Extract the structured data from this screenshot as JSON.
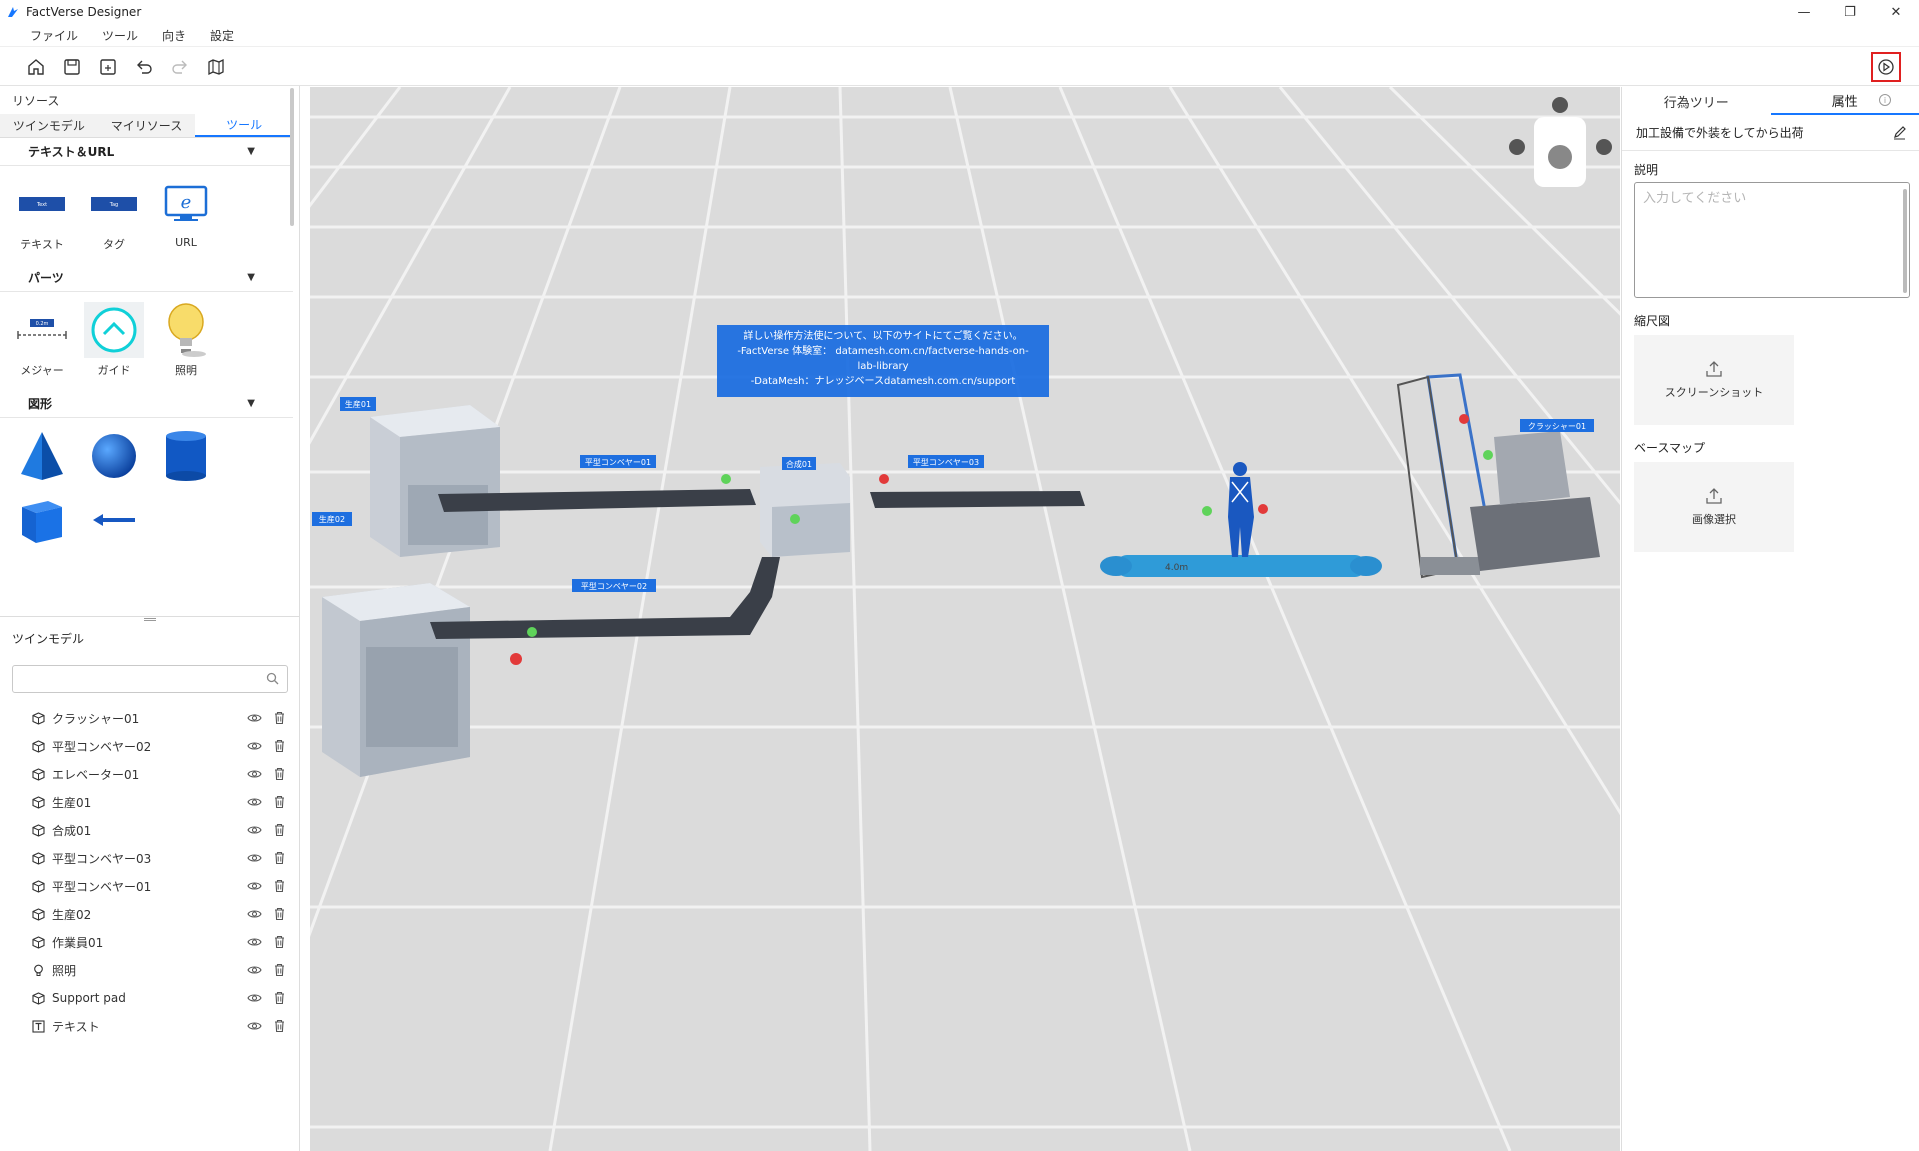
{
  "window": {
    "title": "FactVerse Designer",
    "minimize": "—",
    "restore": "❐",
    "close": "✕"
  },
  "menu": [
    "ファイル",
    "ツール",
    "向き",
    "設定"
  ],
  "left": {
    "resources_title": "リソース",
    "tabs": [
      {
        "label": "ツインモデル"
      },
      {
        "label": "マイリソース"
      },
      {
        "label": "ツール"
      }
    ],
    "groups": {
      "text_url": {
        "title": "テキスト＆URL",
        "items": [
          "テキスト",
          "タグ",
          "URL"
        ]
      },
      "parts": {
        "title": "パーツ",
        "items": [
          "メジャー",
          "ガイド",
          "照明"
        ]
      },
      "shapes": {
        "title": "図形"
      }
    },
    "tool_thumbs": {
      "text": "Text",
      "tag": "Tag",
      "measure": "0.2m"
    },
    "twin_title": "ツインモデル",
    "search_placeholder": "",
    "models": [
      {
        "label": "クラッシャー01",
        "icon": "cube-icon"
      },
      {
        "label": "平型コンベヤー02",
        "icon": "cube-icon"
      },
      {
        "label": "エレベーター01",
        "icon": "cube-icon"
      },
      {
        "label": "生産01",
        "icon": "cube-icon"
      },
      {
        "label": "合成01",
        "icon": "cube-icon"
      },
      {
        "label": "平型コンベヤー03",
        "icon": "cube-icon"
      },
      {
        "label": "平型コンベヤー01",
        "icon": "cube-icon"
      },
      {
        "label": "生産02",
        "icon": "cube-icon"
      },
      {
        "label": "作業員01",
        "icon": "cube-icon"
      },
      {
        "label": "照明",
        "icon": "bulb-icon"
      },
      {
        "label": "Support pad",
        "icon": "cube-icon"
      },
      {
        "label": "テキスト",
        "icon": "text-icon"
      }
    ]
  },
  "viewport": {
    "info_lines": [
      "詳しい操作方法使について、以下のサイトにてご覧ください。",
      "-FactVerse 体験室： datamesh.com.cn/factverse-hands-on-",
      "lab-library",
      "-DataMesh：ナレッジベースdatamesh.com.cn/support"
    ],
    "labels": {
      "prod01": "生産01",
      "prod02": "生産02",
      "conv01": "平型コンベヤー01",
      "conv02": "平型コンベヤー02",
      "conv03": "平型コンベヤー03",
      "synth01": "合成01",
      "crusher01": "クラッシャー01",
      "measure": "4.0m"
    }
  },
  "right": {
    "tabs": [
      {
        "label": "行為ツリー"
      },
      {
        "label": "属性"
      }
    ],
    "behavior_name": "加工設備で外装をしてから出荷",
    "description_label": "説明",
    "description_placeholder": "入力してください",
    "thumbnail_label": "縮尺図",
    "screenshot_label": "スクリーンショット",
    "basemap_label": "ベースマップ",
    "select_image_label": "画像選択"
  },
  "colors": {
    "accent": "#1677ff",
    "highlight": "#e02020",
    "floor": "#dcdcdc"
  }
}
